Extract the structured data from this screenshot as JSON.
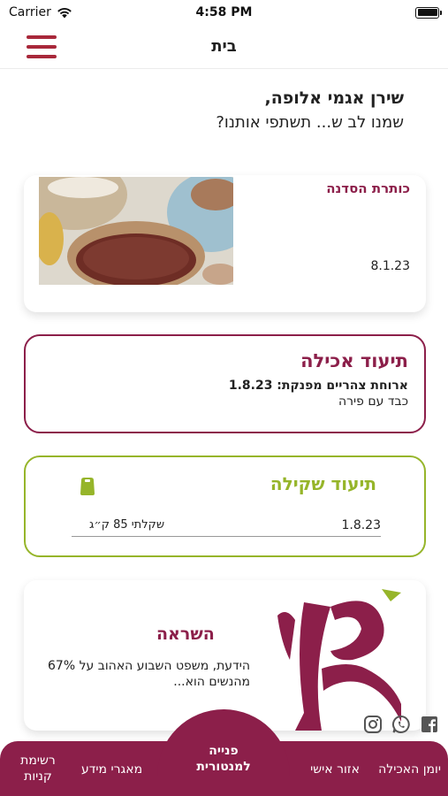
{
  "status_bar": {
    "carrier": "Carrier",
    "time": "4:58 PM"
  },
  "header": {
    "title": "בית"
  },
  "greeting": {
    "title": "שירן אגמי אלופה,",
    "subtitle": "שמנו לב ש... תשתפי אותנו?"
  },
  "workshop_card": {
    "title": "כותרת הסדנה",
    "date": "8.1.23"
  },
  "food_log": {
    "title": "תיעוד אכילה",
    "meal_line": "ארוחת צהריים מפנקת: 1.8.23",
    "description": "כבד עם פירה"
  },
  "weight_log": {
    "title": "תיעוד שקילה",
    "date": "1.8.23",
    "entry": "שקלתי 85 ק״ג"
  },
  "inspiration": {
    "title": "השראה",
    "text": "הידעת, משפט השבוע האהוב על 67% מהנשים הוא..."
  },
  "social": {
    "icons": [
      "instagram-icon",
      "whatsapp-icon",
      "facebook-icon"
    ]
  },
  "bottom_nav": {
    "food_journal": "יומן האכילה",
    "personal_area": "אזור אישי",
    "mentor_line1": "פנייה",
    "mentor_line2": "למנטורית",
    "info_database": "מאגרי מידע",
    "shopping_line1": "רשימת",
    "shopping_line2": "קניות"
  },
  "colors": {
    "brand": "#8c1f4a",
    "accent_green": "#96b52a",
    "menu_red": "#a8283a"
  }
}
